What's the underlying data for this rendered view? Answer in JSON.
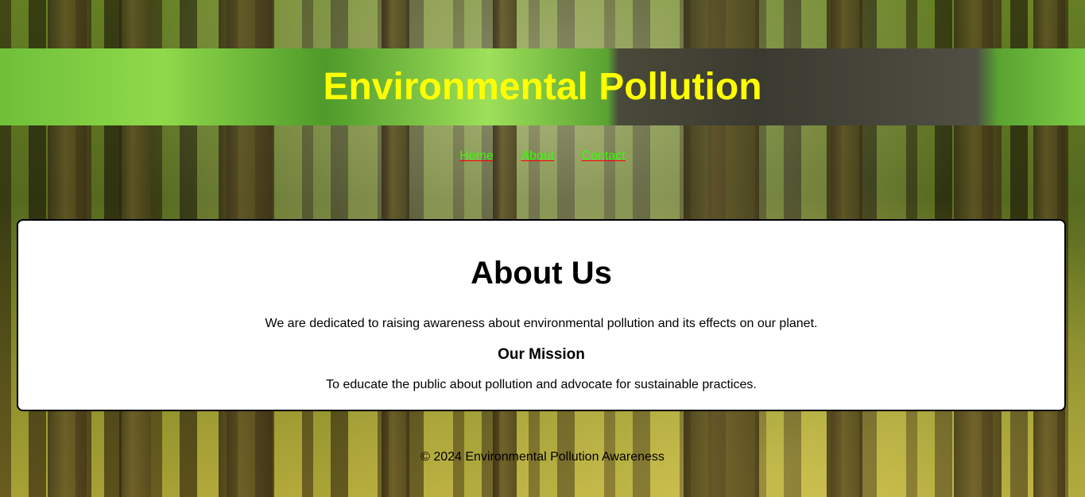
{
  "header": {
    "title": "Environmental Pollution"
  },
  "nav": {
    "items": [
      {
        "label": "Home"
      },
      {
        "label": "About"
      },
      {
        "label": "Contact"
      }
    ]
  },
  "about": {
    "heading": "About Us",
    "intro": "We are dedicated to raising awareness about environmental pollution and its effects on our planet.",
    "mission_heading": "Our Mission",
    "mission_text": "To educate the public about pollution and advocate for sustainable practices."
  },
  "footer": {
    "text": "© 2024 Environmental Pollution Awareness"
  },
  "colors": {
    "title": "#ffff00",
    "nav_link": "#33ff00",
    "nav_underline": "#ff0000"
  }
}
